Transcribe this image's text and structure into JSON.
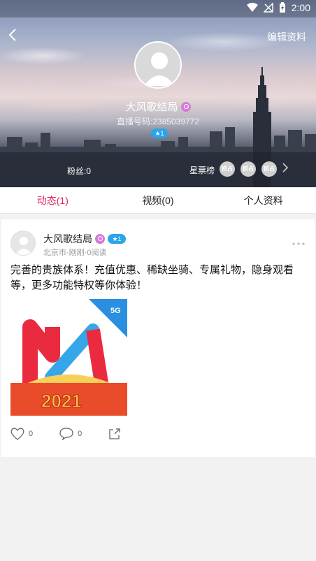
{
  "status_bar": {
    "time": "2:00"
  },
  "header": {
    "edit_label": "编辑资料",
    "nickname": "大风歌结局",
    "live_id": "直播号码:2385039772",
    "level": "1",
    "fans": "粉丝:0",
    "star_rank_label": "星票榜",
    "rank_avatars": [
      "抓占",
      "抓占",
      "抓占"
    ]
  },
  "tabs": [
    {
      "label": "动态(1)",
      "active": true
    },
    {
      "label": "视频(0)",
      "active": false
    },
    {
      "label": "个人资料",
      "active": false
    }
  ],
  "post": {
    "author": "大风歌结局",
    "level": "1",
    "meta": "北京市·刚刚·0阅读",
    "text": "完善的贵族体系！充值优惠、稀缺坐骑、专属礼物，隐身观看等，更多功能特权等你体验！",
    "image_text": "2021",
    "like_count": "0",
    "comment_count": "0"
  },
  "colors": {
    "accent": "#e0285b",
    "level_badge": "#2aa4ea",
    "tag": "#d67ad8"
  }
}
